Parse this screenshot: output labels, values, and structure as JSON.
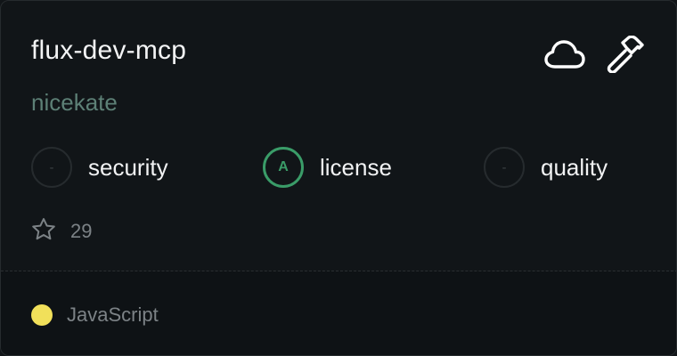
{
  "card": {
    "title": "flux-dev-mcp",
    "author": "nicekate",
    "icons": {
      "hosting": "cloud-icon",
      "tools": "hammer-icon"
    },
    "scores": [
      {
        "label": "security",
        "value": "-",
        "graded": false
      },
      {
        "label": "license",
        "value": "A",
        "graded": true
      },
      {
        "label": "quality",
        "value": "-",
        "graded": false
      }
    ],
    "stars": {
      "icon": "star-icon",
      "count": "29"
    },
    "language": {
      "name": "JavaScript",
      "color": "#f1e05a"
    }
  }
}
